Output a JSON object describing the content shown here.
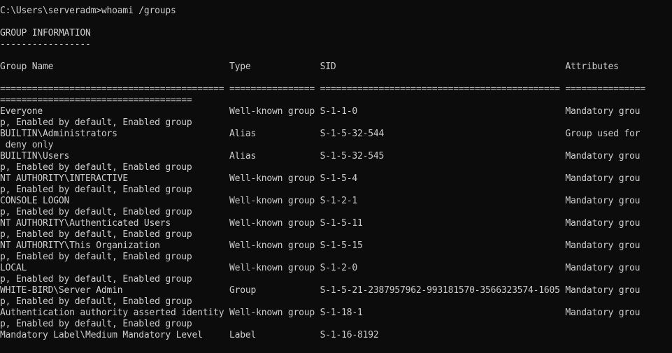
{
  "terminal": {
    "background": "#0c0c0c",
    "foreground": "#cccccc",
    "lines": [
      "C:\\Users\\serveradm>whoami /groups",
      "",
      "GROUP INFORMATION",
      "-----------------",
      "",
      "Group Name                                 Type             SID                                           Attributes",
      "",
      "========================================== ================ ============================================= ===============",
      "====================================",
      "Everyone                                   Well-known group S-1-1-0                                       Mandatory grou",
      "p, Enabled by default, Enabled group",
      "BUILTIN\\Administrators                     Alias            S-1-5-32-544                                  Group used for",
      " deny only",
      "BUILTIN\\Users                              Alias            S-1-5-32-545                                  Mandatory grou",
      "p, Enabled by default, Enabled group",
      "NT AUTHORITY\\INTERACTIVE                   Well-known group S-1-5-4                                       Mandatory grou",
      "p, Enabled by default, Enabled group",
      "CONSOLE LOGON                              Well-known group S-1-2-1                                       Mandatory grou",
      "p, Enabled by default, Enabled group",
      "NT AUTHORITY\\Authenticated Users           Well-known group S-1-5-11                                      Mandatory grou",
      "p, Enabled by default, Enabled group",
      "NT AUTHORITY\\This Organization             Well-known group S-1-5-15                                      Mandatory grou",
      "p, Enabled by default, Enabled group",
      "LOCAL                                      Well-known group S-1-2-0                                       Mandatory grou",
      "p, Enabled by default, Enabled group",
      "WHITE-BIRD\\Server Admin                    Group            S-1-5-21-2387957962-993181570-3566323574-1605 Mandatory grou",
      "p, Enabled by default, Enabled group",
      "Authentication authority asserted identity Well-known group S-1-18-1                                      Mandatory grou",
      "p, Enabled by default, Enabled group",
      "Mandatory Label\\Medium Mandatory Level     Label            S-1-16-8192"
    ]
  }
}
